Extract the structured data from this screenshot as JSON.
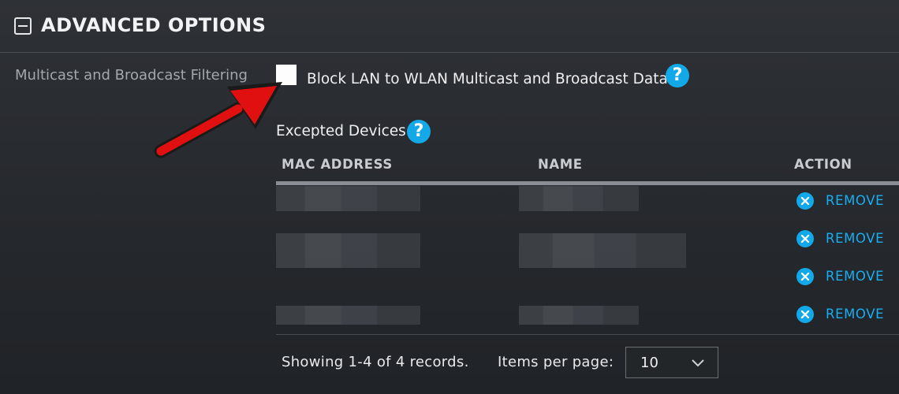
{
  "section": {
    "title": "ADVANCED OPTIONS",
    "toggle_icon": "minus-square-icon"
  },
  "multicast": {
    "label": "Multicast and Broadcast Filtering",
    "checkbox_label": "Block LAN to WLAN Multicast and Broadcast Data",
    "checked": false,
    "help_glyph": "?"
  },
  "excepted": {
    "title": "Excepted Devices",
    "help_glyph": "?",
    "columns": [
      "MAC ADDRESS",
      "NAME",
      "ACTION"
    ],
    "rows": [
      {
        "mac": "[redacted]",
        "name": "[redacted]",
        "action": "REMOVE"
      },
      {
        "mac": "[redacted]",
        "name": "[redacted]",
        "action": "REMOVE"
      },
      {
        "mac": "[redacted]",
        "name": "[redacted]",
        "action": "REMOVE"
      },
      {
        "mac": "[redacted]",
        "name": "[redacted]",
        "action": "REMOVE"
      }
    ]
  },
  "pagination": {
    "showing": "Showing 1-4 of 4 records.",
    "items_per_page_label": "Items per page:",
    "items_per_page_value": "10"
  },
  "colors": {
    "accent": "#13a9e8",
    "annotation_arrow": "#e01010",
    "background": "#2a2d31"
  },
  "annotation": {
    "icon": "red-arrow-icon"
  }
}
